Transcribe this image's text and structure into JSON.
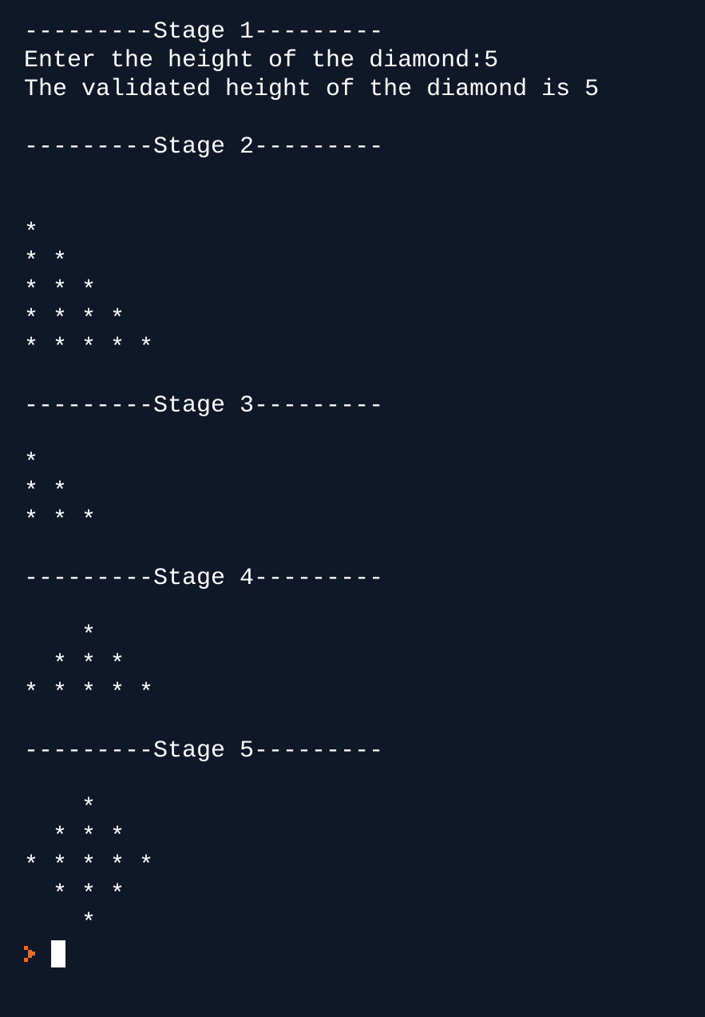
{
  "terminal": {
    "lines": [
      "---------Stage 1---------",
      "Enter the height of the diamond:5",
      "The validated height of the diamond is 5",
      "",
      "---------Stage 2---------",
      "",
      "",
      "*",
      "* *",
      "* * *",
      "* * * *",
      "* * * * *",
      "",
      "---------Stage 3---------",
      "",
      "*",
      "* *",
      "* * *",
      "",
      "---------Stage 4---------",
      "",
      "    *",
      "  * * *",
      "* * * * *",
      "",
      "---------Stage 5---------",
      "",
      "    *",
      "  * * *",
      "* * * * *",
      "  * * *",
      "    *"
    ]
  },
  "prompt": {
    "icon": "prompt-chevron-icon",
    "color": "#f26b21"
  },
  "colors": {
    "background": "#0f1729",
    "text": "#ffffff"
  }
}
